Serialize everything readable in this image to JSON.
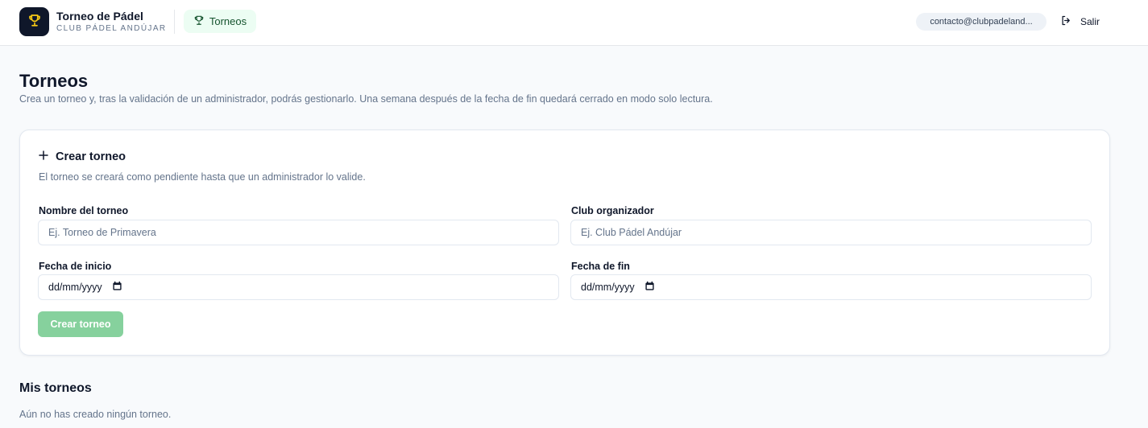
{
  "header": {
    "app_title": "Torneo de Pádel",
    "app_subtitle": "CLUB PÁDEL ANDÚJAR",
    "logo_icon": "trophy-icon",
    "nav_item": "Torneos",
    "nav_icon": "trophy-icon",
    "user_email": "contacto@clubpadeland...",
    "logout_label": "Salir",
    "logout_icon": "logout-icon"
  },
  "page": {
    "title": "Torneos",
    "description": "Crea un torneo y, tras la validación de un administrador, podrás gestionarlo. Una semana después de la fecha de fin quedará cerrado en modo solo lectura."
  },
  "create_form": {
    "title": "Crear torneo",
    "title_icon": "plus-icon",
    "description": "El torneo se creará como pendiente hasta que un administrador lo valide.",
    "name_label": "Nombre del torneo",
    "name_placeholder": "Ej. Torneo de Primavera",
    "club_label": "Club organizador",
    "club_placeholder": "Ej. Club Pádel Andújar",
    "start_label": "Fecha de inicio",
    "start_value": "dd/mm/yyyy",
    "end_label": "Fecha de fin",
    "end_value": "dd/mm/yyyy",
    "submit_label": "Crear torneo"
  },
  "my_tournaments": {
    "title": "Mis torneos",
    "empty_message": "Aún no has creado ningún torneo."
  },
  "colors": {
    "accent": "#22c55e",
    "accent_disabled": "#86d19d",
    "logo_bg": "#0f172a",
    "logo_icon": "#facc15",
    "nav_bg": "#ecfdf3"
  }
}
